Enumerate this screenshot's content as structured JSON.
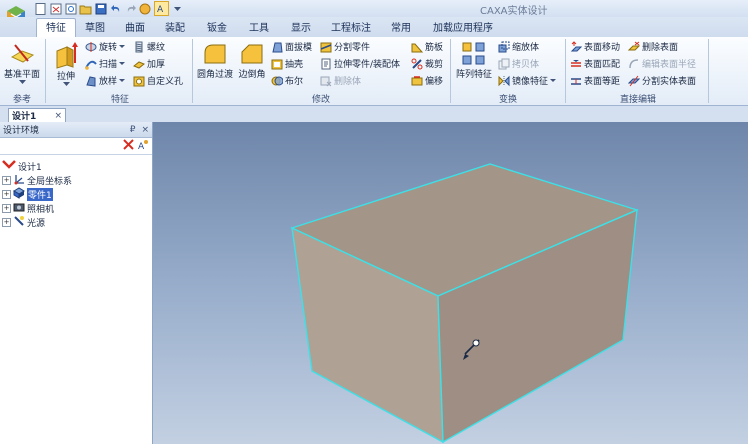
{
  "app": {
    "title": "CAXA实体设计"
  },
  "tabs": [
    "特征",
    "草图",
    "曲面",
    "装配",
    "钣金",
    "工具",
    "显示",
    "工程标注",
    "常用",
    "加载应用程序"
  ],
  "active_tab": 0,
  "ribbon": {
    "ref_group": {
      "label": "参考",
      "base_plane": "基准平面"
    },
    "feature_group": {
      "label": "特征",
      "extrude": "拉伸",
      "revolve": "旋转",
      "sweep": "扫描",
      "loft": "放样",
      "thread": "螺纹",
      "thicken": "加厚",
      "custom_hole": "自定义孔"
    },
    "modify_group": {
      "label": "修改",
      "fillet": "圆角过渡",
      "chamfer": "边倒角",
      "draft": "面拔模",
      "shell": "抽壳",
      "boolean": "布尔",
      "split_part": "分割零件",
      "extrude_asm": "拉伸零件/装配体",
      "delete_body": "删除体",
      "rib": "筋板",
      "trim": "裁剪",
      "offset": "偏移"
    },
    "transform_group": {
      "label": "变换",
      "array": "阵列特征",
      "scale": "缩放体",
      "copy_body": "拷贝体",
      "mirror": "镜像特征"
    },
    "direct_group": {
      "label": "直接编辑",
      "move_face": "表面移动",
      "match_face": "表面匹配",
      "equal_face": "表面等距",
      "delete_face": "删除表面",
      "edit_radius": "编辑表面半径",
      "split_solid": "分割实体表面"
    }
  },
  "document_tab": {
    "label": "设计1",
    "close": "×"
  },
  "panel": {
    "title": "设计环境",
    "pin": "₽",
    "close": "×"
  },
  "tree": [
    {
      "label": "设计1",
      "expander": ""
    },
    {
      "label": "全局坐标系",
      "expander": "+"
    },
    {
      "label": "零件1",
      "expander": "+",
      "selected": true
    },
    {
      "label": "照相机",
      "expander": "+"
    },
    {
      "label": "光源",
      "expander": "+"
    }
  ],
  "colors": {
    "box_face": "#a99d92",
    "box_edge": "#3de0e6",
    "viewport_top": "#6e86aa",
    "selection": "#3a68c9"
  }
}
